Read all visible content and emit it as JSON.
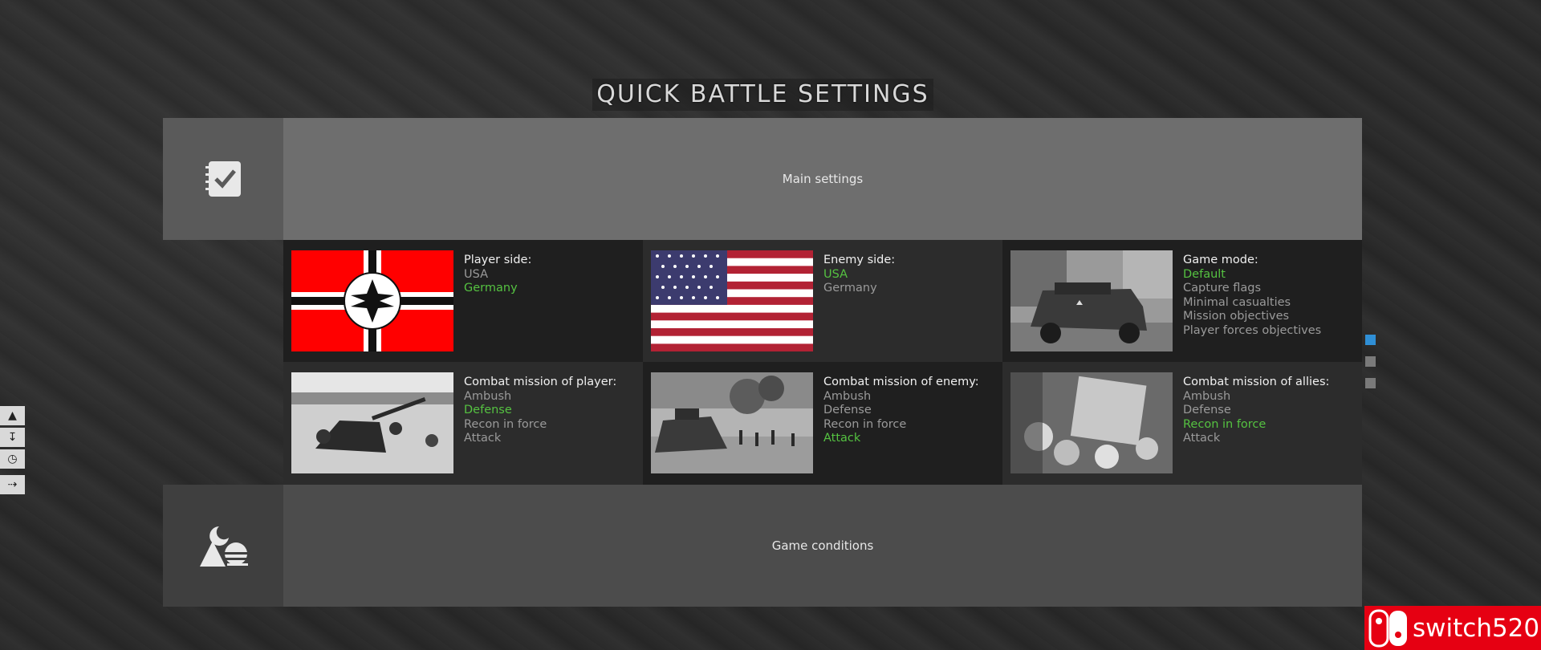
{
  "title": "QUICK BATTLE SETTINGS",
  "main_settings": {
    "label": "Main settings",
    "icon": "checklist-icon"
  },
  "game_conditions": {
    "label": "Game conditions",
    "icon": "landscape-moon-icon"
  },
  "cells": {
    "player_side": {
      "label": "Player side:",
      "options": [
        "USA",
        "Germany"
      ],
      "selected": "Germany",
      "image": "german-war-flag"
    },
    "enemy_side": {
      "label": "Enemy side:",
      "options": [
        "USA",
        "Germany"
      ],
      "selected": "USA",
      "image": "us-flag"
    },
    "game_mode": {
      "label": "Game mode:",
      "options": [
        "Default",
        "Capture flags",
        "Minimal casualties",
        "Mission objectives",
        "Player forces objectives"
      ],
      "selected": "Default",
      "image": "halftrack-photo"
    },
    "mission_player": {
      "label": "Combat mission of player:",
      "options": [
        "Ambush",
        "Defense",
        "Recon in force",
        "Attack"
      ],
      "selected": "Defense",
      "image": "anti-tank-gun-photo"
    },
    "mission_enemy": {
      "label": "Combat mission of enemy:",
      "options": [
        "Ambush",
        "Defense",
        "Recon in force",
        "Attack"
      ],
      "selected": "Attack",
      "image": "tank-infantry-photo"
    },
    "mission_allies": {
      "label": "Combat mission of allies:",
      "options": [
        "Ambush",
        "Defense",
        "Recon in force",
        "Attack"
      ],
      "selected": "Recon in force",
      "image": "soldiers-vehicle-photo"
    }
  },
  "side_tools": [
    "pin-icon",
    "collapse-icon",
    "clock-icon",
    "exit-icon"
  ],
  "pager": {
    "pages": 3,
    "active": 1
  },
  "watermark": {
    "text": "switch520"
  },
  "colors": {
    "selected": "#55c241",
    "unselected": "#9a9a9a",
    "pager_active": "#2f8fd6"
  }
}
